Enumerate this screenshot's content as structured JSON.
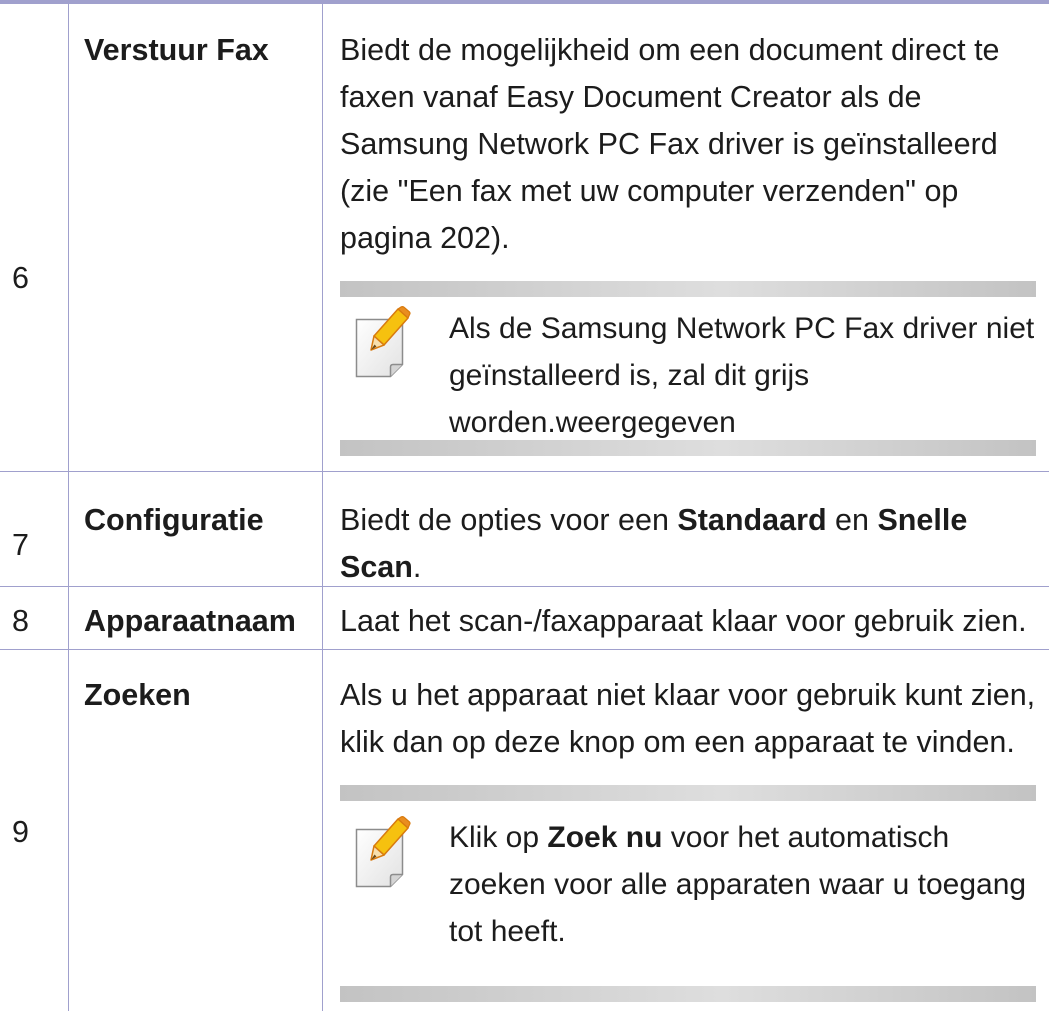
{
  "rows": [
    {
      "number": "6",
      "name": "Verstuur Fax",
      "description": [
        "Biedt de mogelijkheid om een document direct te",
        "faxen vanaf Easy Document Creator als de",
        "Samsung Network PC Fax driver is geïnstalleerd",
        "(zie \"Een fax met uw computer verzenden\" op",
        "pagina 202)."
      ],
      "note": {
        "icon": "note-pencil-icon",
        "lines": [
          "Als de Samsung Network PC Fax driver niet",
          "geïnstalleerd is, zal dit grijs",
          "worden.weergegeven"
        ]
      }
    },
    {
      "number": "7",
      "name": "Configuratie",
      "description": [
        [
          "Biedt de opties voor een ",
          "Standaard",
          " en ",
          "Snelle"
        ],
        [
          "Scan",
          "."
        ]
      ]
    },
    {
      "number": "8",
      "name": "Apparaatnaam",
      "description": [
        "Laat het scan-/faxapparaat klaar voor gebruik zien."
      ]
    },
    {
      "number": "9",
      "name": "Zoeken",
      "description": [
        "Als u het apparaat niet klaar voor gebruik kunt zien,",
        "klik dan op deze knop om een apparaat te vinden."
      ],
      "note": {
        "icon": "note-pencil-icon",
        "lines": [
          [
            "Klik op ",
            "Zoek nu",
            " voor het automatisch"
          ],
          "zoeken voor alle apparaten waar u toegang",
          "tot heeft."
        ]
      }
    }
  ],
  "colors": {
    "rule": "#a0a0cd",
    "note_bar_dark": "#c3c3c3",
    "note_bar_light": "#dedede",
    "text": "#1c1c1c"
  }
}
